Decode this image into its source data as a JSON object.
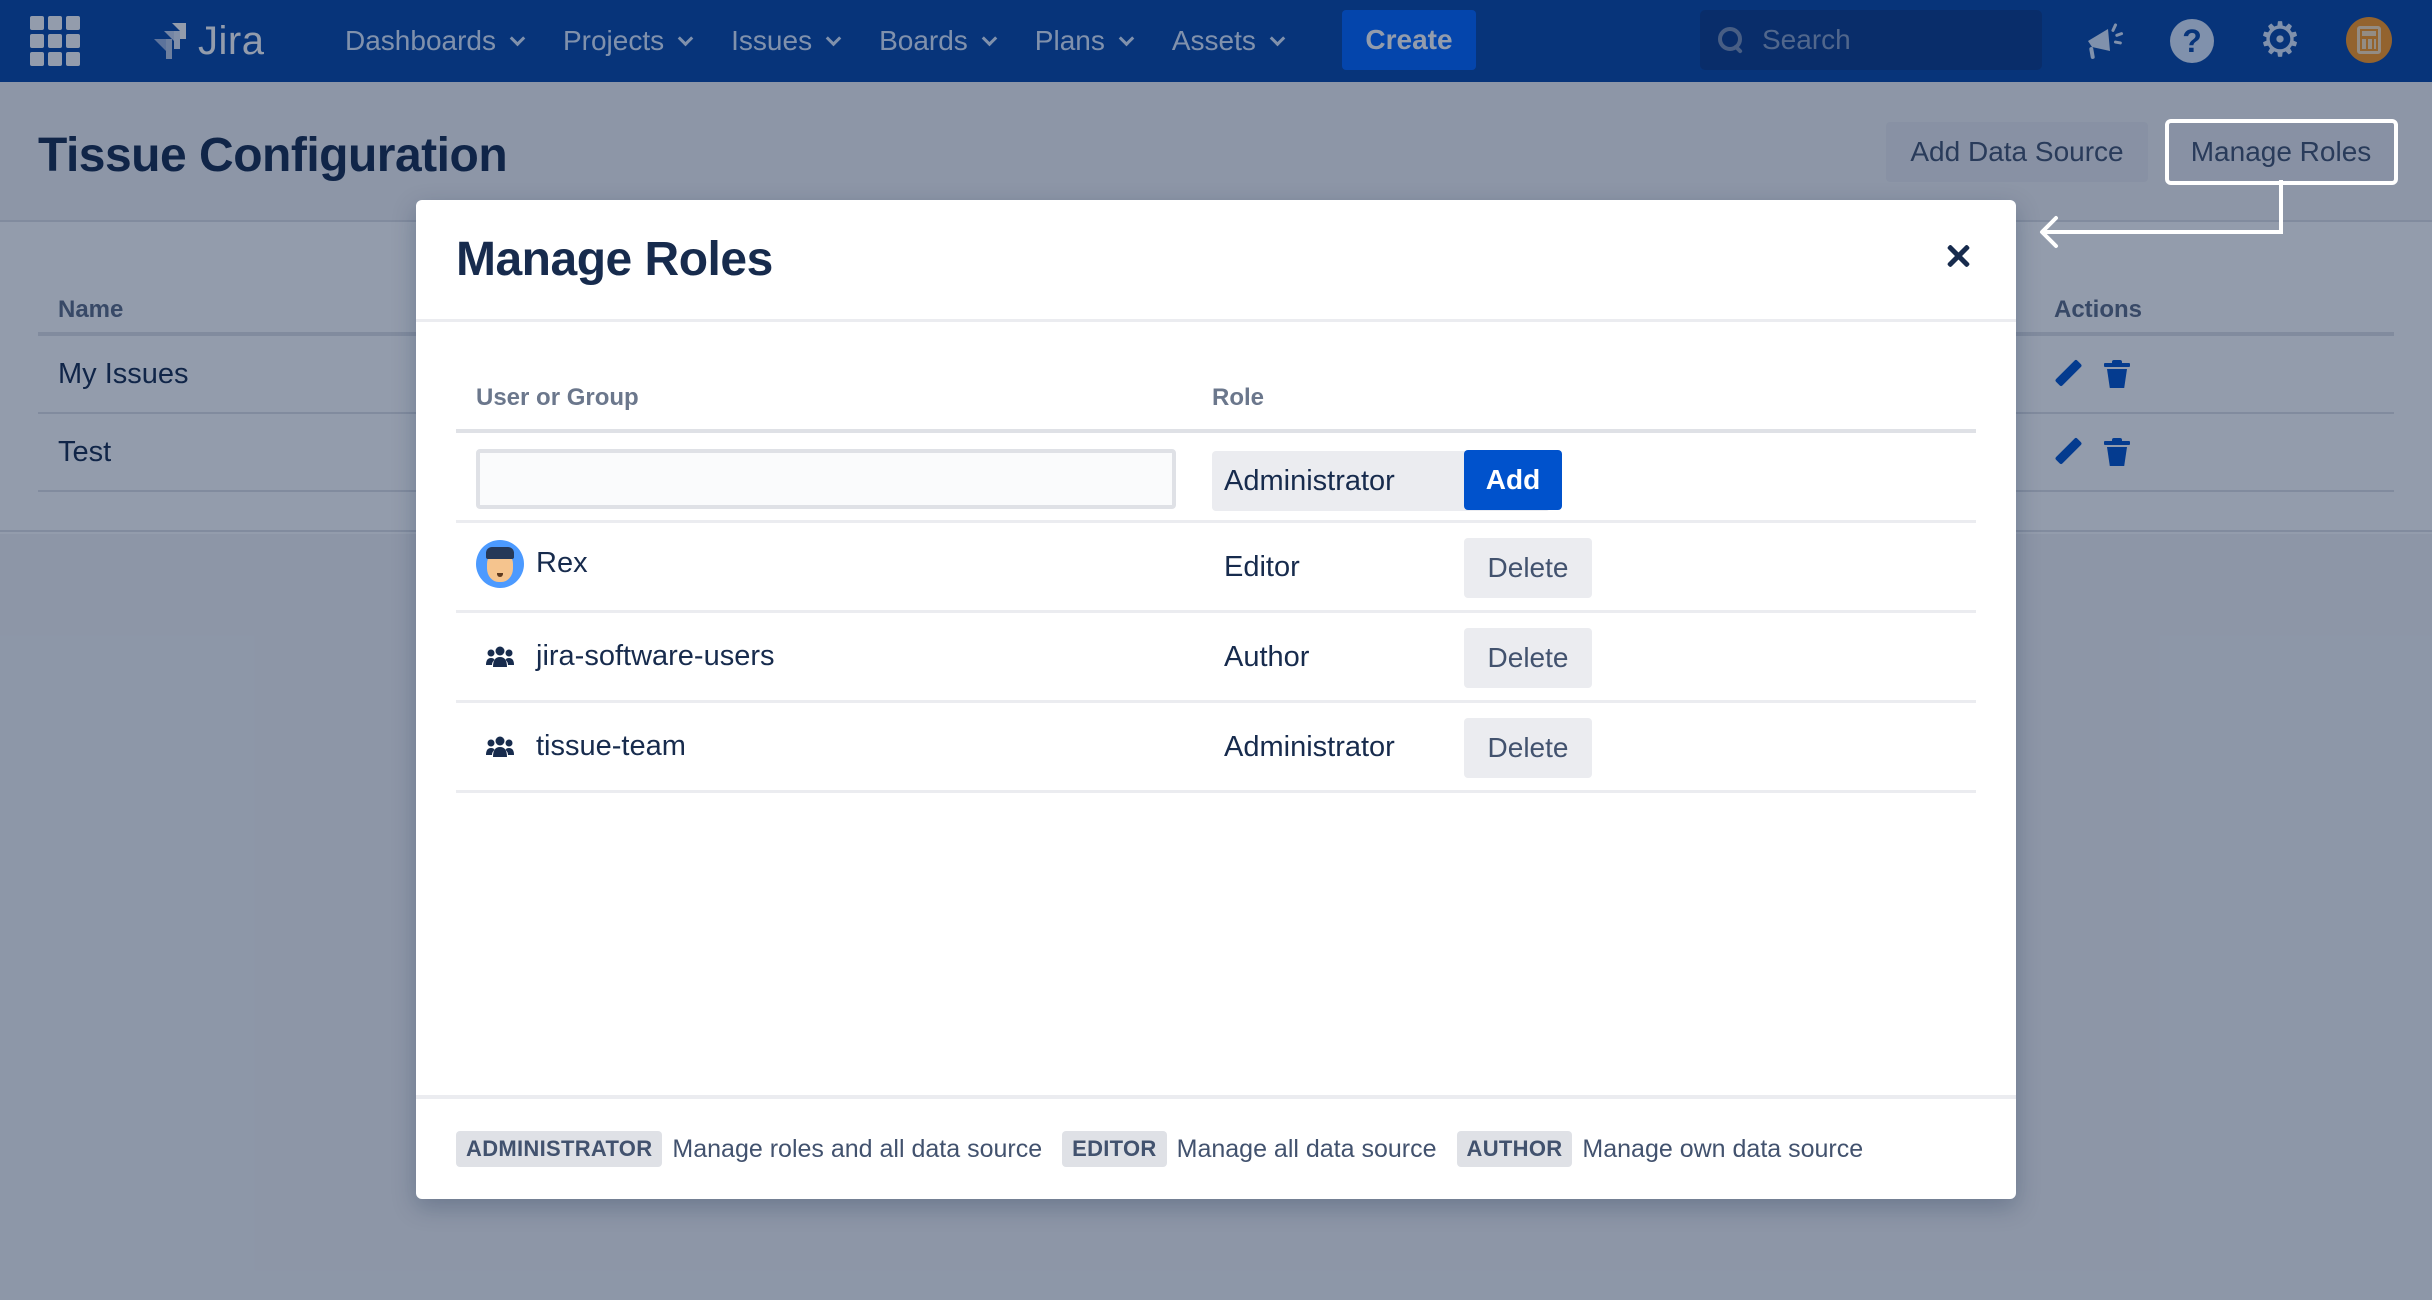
{
  "navbar": {
    "logo_text": "Jira",
    "menu": [
      {
        "label": "Dashboards"
      },
      {
        "label": "Projects"
      },
      {
        "label": "Issues"
      },
      {
        "label": "Boards"
      },
      {
        "label": "Plans"
      },
      {
        "label": "Assets"
      }
    ],
    "create_label": "Create",
    "search_placeholder": "Search",
    "icons": [
      "app-switcher-icon",
      "notifications-icon",
      "help-icon",
      "settings-icon",
      "profile-avatar"
    ]
  },
  "page": {
    "title": "Tissue Configuration",
    "add_data_source_label": "Add Data Source",
    "manage_roles_label": "Manage Roles",
    "table": {
      "columns": [
        "Name",
        "Actions"
      ],
      "rows": [
        {
          "name": "My Issues"
        },
        {
          "name": "Test"
        }
      ]
    }
  },
  "modal": {
    "title": "Manage Roles",
    "columns": {
      "user": "User or Group",
      "role": "Role"
    },
    "new_entry": {
      "user_value": "",
      "role_selected": "Administrator",
      "add_label": "Add"
    },
    "members": [
      {
        "name": "Rex",
        "type": "user",
        "role": "Editor",
        "action": "Delete"
      },
      {
        "name": "jira-software-users",
        "type": "group",
        "role": "Author",
        "action": "Delete"
      },
      {
        "name": "tissue-team",
        "type": "group",
        "role": "Administrator",
        "action": "Delete"
      }
    ],
    "legend": [
      {
        "badge": "ADMINISTRATOR",
        "desc": "Manage roles and all data source"
      },
      {
        "badge": "EDITOR",
        "desc": "Manage all data source"
      },
      {
        "badge": "AUTHOR",
        "desc": "Manage own data source"
      }
    ]
  },
  "colors": {
    "brand": "#0747a6",
    "primary_button": "#0052cc",
    "text": "#172b4d",
    "overlay": "rgba(9,30,66,0.44)"
  }
}
